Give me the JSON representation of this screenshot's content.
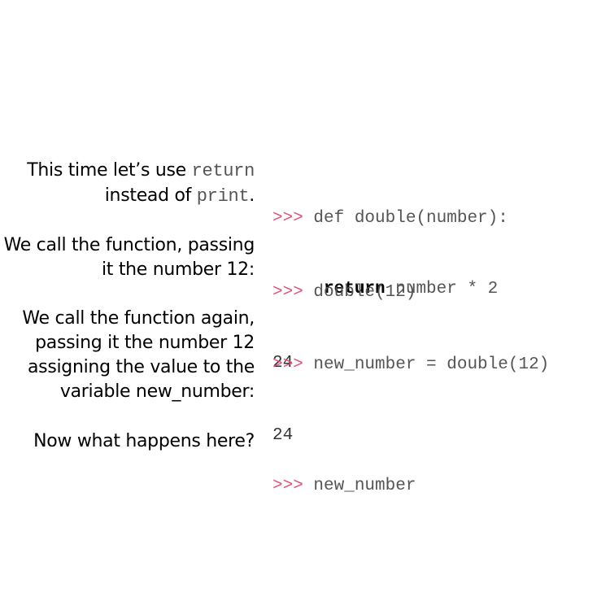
{
  "blocks": [
    {
      "explanation_before": "This time let’s use ",
      "explanation_code1": "return",
      "explanation_mid": "instead of ",
      "explanation_code2": "print",
      "explanation_after": ".",
      "prompt": ">>>",
      "code_line1": "def double(number):",
      "code_indent": "     ",
      "code_keyword": "return",
      "code_line2_rest": " number * 2"
    },
    {
      "explanation_line1": "We call the function, passing",
      "explanation_line2": "it the number 12:",
      "prompt": ">>>",
      "code_line1": "double(12)",
      "output": "24"
    },
    {
      "explanation_line1": "We call the function again,",
      "explanation_line2": "passing it the number 12",
      "explanation_line3": "assigning the value to the",
      "explanation_line4": "variable new_number:",
      "prompt": ">>>",
      "code_line1": "new_number = double(12)",
      "output": "24"
    },
    {
      "explanation_line1": "Now what happens here?",
      "prompt": ">>>",
      "code_line1": "new_number"
    }
  ],
  "colors": {
    "prompt": "#e0557a",
    "code": "#555555",
    "text": "#000000"
  }
}
